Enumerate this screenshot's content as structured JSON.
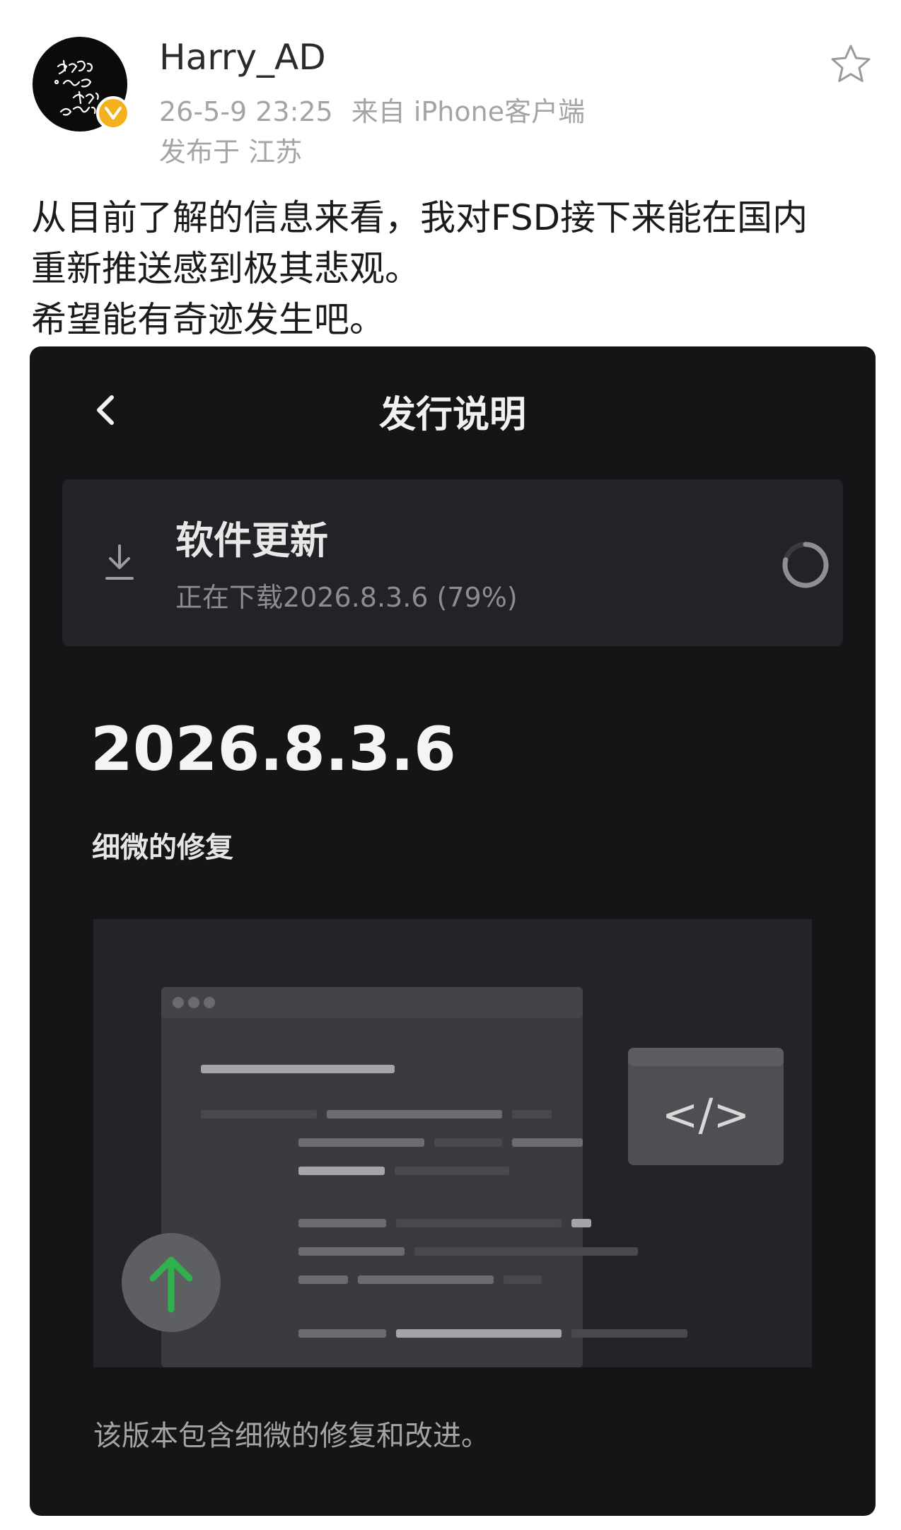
{
  "post": {
    "username": "Harry_AD",
    "time": "26-5-9 23:25",
    "source": "来自 iPhone客户端",
    "location": "发布于 江苏",
    "text_lines": [
      "从目前了解的信息来看，我对FSD接下来能在国内",
      "重新推送感到极其悲观。",
      "希望能有奇迹发生吧。"
    ],
    "icons": {
      "favorite": "star-outline-icon",
      "verified": "verified-badge-icon"
    },
    "colors": {
      "verified": "#f3b11d"
    }
  },
  "screenshot": {
    "title": "发行说明",
    "update_card": {
      "title": "软件更新",
      "status": "正在下载2026.8.3.6 (79%)",
      "progress_percent": 79
    },
    "version": "2026.8.3.6",
    "subtitle": "细微的修复",
    "illustration": {
      "code_symbol": "</>"
    },
    "description": "该版本包含细微的修复和改进。",
    "icons": {
      "back": "chevron-left-icon",
      "download": "download-icon",
      "spinner": "loading-spinner-icon",
      "upload": "arrow-up-icon"
    },
    "colors": {
      "accent_green": "#2fb24c",
      "background": "#141517"
    }
  }
}
